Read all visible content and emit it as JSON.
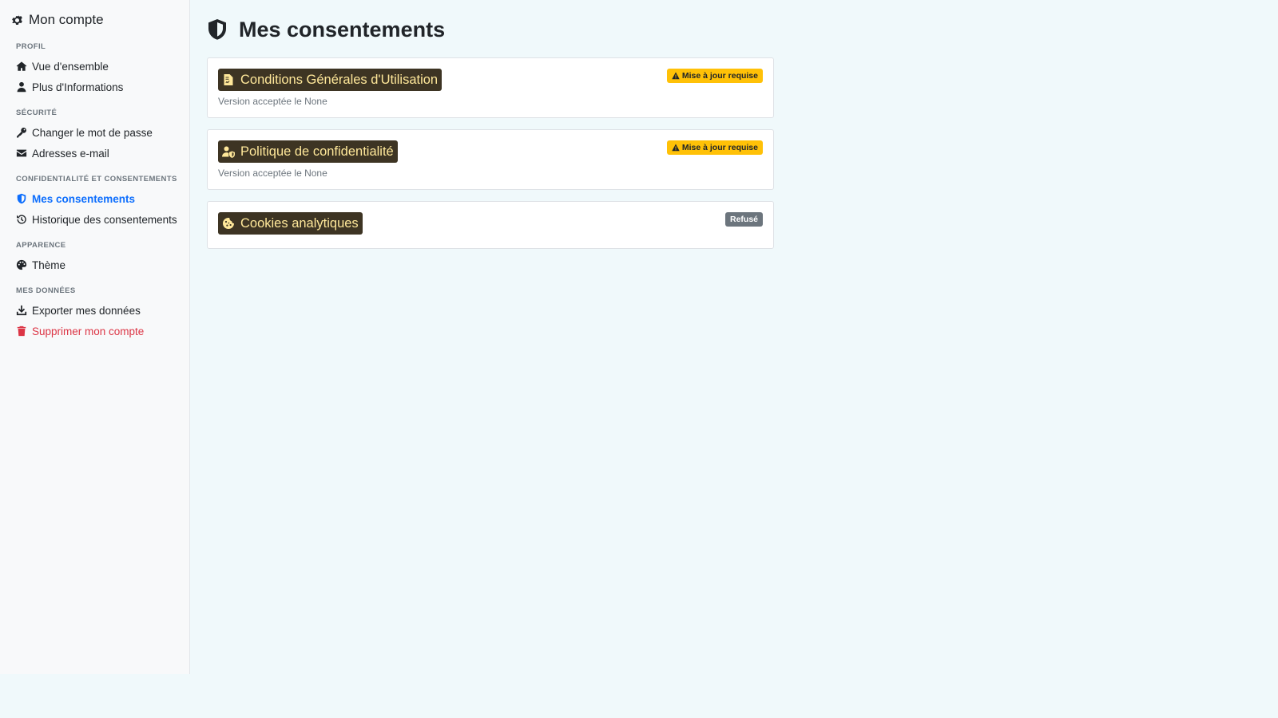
{
  "sidebar": {
    "title": "Mon compte",
    "sections": [
      {
        "label": "PROFIL",
        "items": [
          "Vue d'ensemble",
          "Plus d'Informations"
        ]
      },
      {
        "label": "SÉCURITÉ",
        "items": [
          "Changer le mot de passe",
          "Adresses e-mail"
        ]
      },
      {
        "label": "CONFIDENTIALITÉ ET CONSENTEMENTS",
        "items": [
          "Mes consentements",
          "Historique des consentements"
        ]
      },
      {
        "label": "APPARENCE",
        "items": [
          "Thème"
        ]
      },
      {
        "label": "MES DONNÉES",
        "items": [
          "Exporter mes données",
          "Supprimer mon compte"
        ]
      }
    ],
    "active_item": "Mes consentements"
  },
  "main": {
    "title": "Mes consentements",
    "cards": [
      {
        "title": "Conditions Générales d'Utilisation",
        "subtitle": "Version acceptée le None",
        "badge": "Mise à jour requise",
        "badge_type": "warning",
        "icon": "file-contract-icon"
      },
      {
        "title": "Politique de confidentialité",
        "subtitle": "Version acceptée le None",
        "badge": "Mise à jour requise",
        "badge_type": "warning",
        "icon": "user-shield-icon"
      },
      {
        "title": "Cookies analytiques",
        "subtitle": "",
        "badge": "Refusé",
        "badge_type": "secondary",
        "icon": "cookie-icon"
      }
    ]
  },
  "colors": {
    "accent": "#0d6efd",
    "danger": "#dc3545",
    "warning": "#ffc107",
    "secondary": "#6c757d",
    "card_title_bg": "#3d3423",
    "card_title_fg": "#ffe89a"
  }
}
